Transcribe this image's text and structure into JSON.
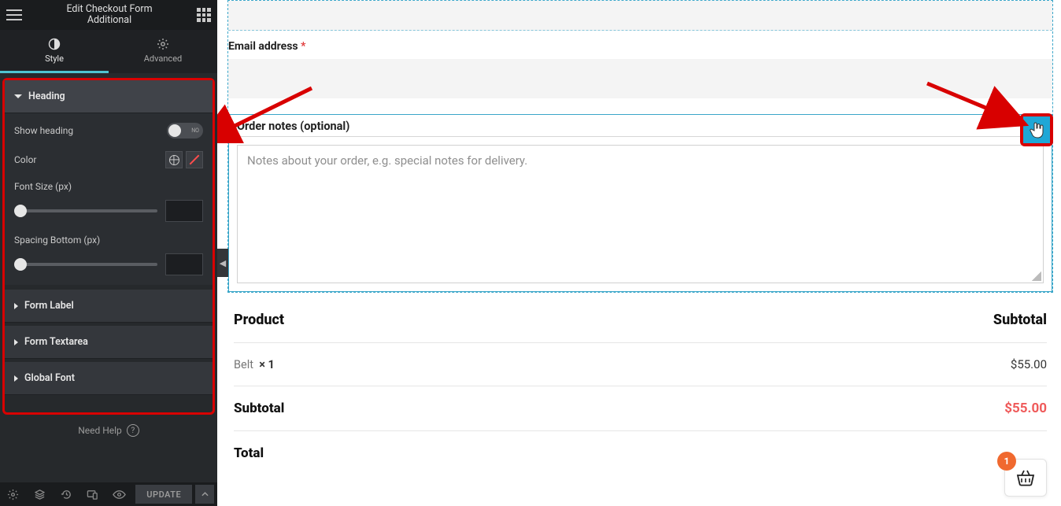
{
  "sidebar": {
    "title_line1": "Edit Checkout Form",
    "title_line2": "Additional",
    "tabs": {
      "style": "Style",
      "advanced": "Advanced"
    },
    "sections": {
      "heading": {
        "title": "Heading",
        "show_heading_label": "Show heading",
        "show_heading_state": "NO",
        "color_label": "Color",
        "font_size_label": "Font Size (px)",
        "spacing_bottom_label": "Spacing Bottom (px)"
      },
      "form_label": "Form Label",
      "form_textarea": "Form Textarea",
      "global_font": "Global Font"
    },
    "help": "Need Help",
    "update_btn": "UPDATE"
  },
  "form": {
    "email_label": "Email address",
    "required_mark": "*",
    "order_notes_label": "Order notes (optional)",
    "order_notes_placeholder": "Notes about your order, e.g. special notes for delivery."
  },
  "review": {
    "product_header": "Product",
    "subtotal_header": "Subtotal",
    "items": [
      {
        "name": "Belt",
        "qty": "× 1",
        "price": "$55.00"
      }
    ],
    "subtotal_label": "Subtotal",
    "subtotal_value": "$55.00",
    "total_label": "Total"
  },
  "cart": {
    "count": "1"
  },
  "colors": {
    "accent": "#1fa7d6",
    "danger": "#d80000",
    "highlight_price": "#ef5a5a",
    "badge": "#f0692f"
  }
}
